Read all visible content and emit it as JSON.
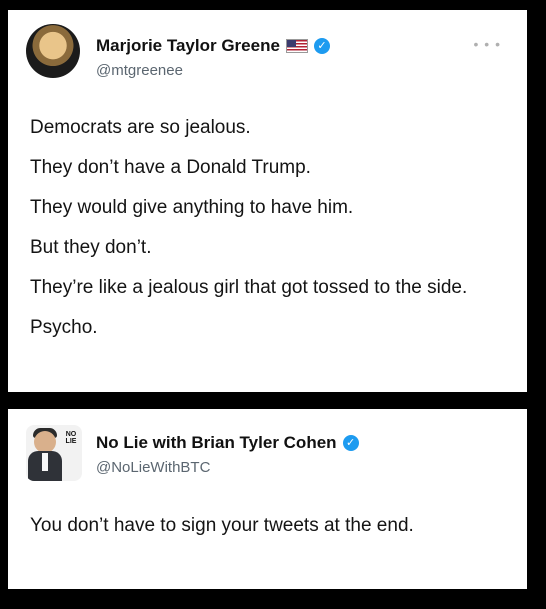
{
  "tweets": [
    {
      "author_name": "Marjorie Taylor Greene",
      "handle": "@mtgreenee",
      "flag_icon": "us-flag-icon",
      "verified_icon": "verified-badge-icon",
      "more_icon": "more-options-icon",
      "lines": [
        "Democrats are so jealous.",
        "They don’t have a Donald Trump.",
        "They would give anything to have him.",
        "But they don’t.",
        "They’re like a jealous girl that got tossed to the side.",
        "Psycho."
      ]
    },
    {
      "author_name": "No Lie with Brian Tyler Cohen",
      "handle": "@NoLieWithBTC",
      "verified_icon": "verified-badge-icon",
      "avatar_logo_text": "NO LIE",
      "text": "You don’t have to sign your tweets at the end."
    }
  ],
  "colors": {
    "background": "#000000",
    "card": "#ffffff",
    "verified": "#1d9bf0",
    "handle": "#5b6670"
  }
}
